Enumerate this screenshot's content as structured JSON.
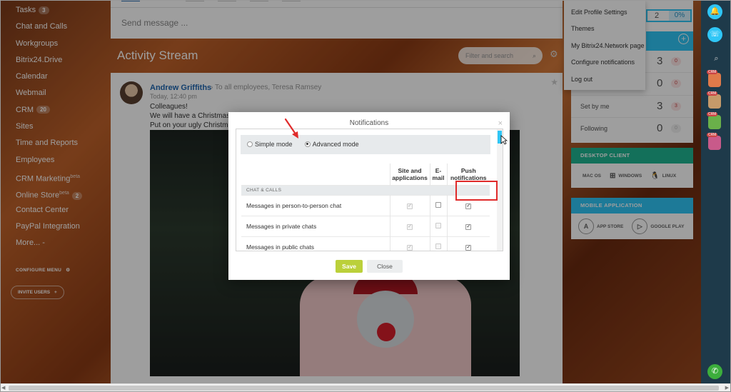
{
  "sidebar": {
    "items": [
      {
        "label": "Tasks",
        "badge": "3",
        "sup": ""
      },
      {
        "label": "Chat and Calls",
        "badge": "",
        "sup": ""
      },
      {
        "label": "Workgroups",
        "badge": "",
        "sup": ""
      },
      {
        "label": "Bitrix24.Drive",
        "badge": "",
        "sup": ""
      },
      {
        "label": "Calendar",
        "badge": "",
        "sup": ""
      },
      {
        "label": "Webmail",
        "badge": "",
        "sup": ""
      },
      {
        "label": "CRM",
        "badge": "20",
        "sup": ""
      },
      {
        "label": "Sites",
        "badge": "",
        "sup": ""
      },
      {
        "label": "Time and Reports",
        "badge": "",
        "sup": ""
      },
      {
        "label": "Employees",
        "badge": "",
        "sup": ""
      },
      {
        "label": "CRM Marketing",
        "badge": "",
        "sup": "beta"
      },
      {
        "label": "Online Store",
        "badge": "2",
        "sup": "beta"
      },
      {
        "label": "Contact Center",
        "badge": "",
        "sup": ""
      },
      {
        "label": "PayPal Integration",
        "badge": "",
        "sup": ""
      },
      {
        "label": "More... -",
        "badge": "",
        "sup": ""
      }
    ],
    "configure_menu": "CONFIGURE MENU",
    "invite_users": "INVITE USERS"
  },
  "composer": {
    "placeholder": "Send message ..."
  },
  "stream": {
    "title": "Activity Stream",
    "search_placeholder": "Filter and search"
  },
  "post": {
    "author": "Andrew Griffiths",
    "recipients": "To all employees, Teresa Ramsey",
    "time": "Today, 12:40 pm",
    "lines": [
      "Colleagues!",
      "We will have a Christmas p",
      "Put on your ugly Christmas"
    ]
  },
  "profile_menu": {
    "items": [
      "Edit Profile Settings",
      "Themes",
      "My Bitrix24.Network page",
      "Configure notifications",
      "Log out"
    ]
  },
  "counters": {
    "progress_number": "2",
    "progress_percent": "0%",
    "rows": [
      {
        "label": "",
        "num": "3",
        "pill": "0"
      },
      {
        "label": "",
        "num": "0",
        "pill": "0"
      },
      {
        "label": "Set by me",
        "num": "3",
        "pill": "3"
      },
      {
        "label": "Following",
        "num": "0",
        "pill": "0"
      }
    ]
  },
  "desktop_client": {
    "title": "DESKTOP CLIENT",
    "items": [
      "MAC OS",
      "WINDOWS",
      "LINUX"
    ]
  },
  "mobile_app": {
    "title": "MOBILE APPLICATION",
    "items": [
      "APP STORE",
      "GOOGLE PLAY"
    ]
  },
  "rail": {
    "tags": [
      "CRM",
      "CRM",
      "CRM",
      "CRM"
    ]
  },
  "dialog": {
    "title": "Notifications",
    "modes": {
      "simple": "Simple mode",
      "advanced": "Advanced mode",
      "selected": "advanced"
    },
    "columns": [
      "Site and applications",
      "E-mail",
      "Push notifications"
    ],
    "column_lines": [
      [
        "Site and",
        "applications"
      ],
      [
        "E-",
        "mail"
      ],
      [
        "Push",
        "notifications"
      ]
    ],
    "section": "CHAT & CALLS",
    "rows": [
      {
        "label": "Messages in person-to-person chat",
        "site": true,
        "email": false,
        "push": true
      },
      {
        "label": "Messages in private chats",
        "site": true,
        "email": false,
        "push": true
      },
      {
        "label": "Messages in public chats",
        "site": true,
        "email": false,
        "push": true
      }
    ],
    "save_label": "Save",
    "close_label": "Close"
  },
  "colors": {
    "accent": "#2fc6f6",
    "save": "#bbd03a",
    "highlight": "#e02b2b",
    "desktop": "#20b591",
    "mobile": "#2fc6f6"
  }
}
